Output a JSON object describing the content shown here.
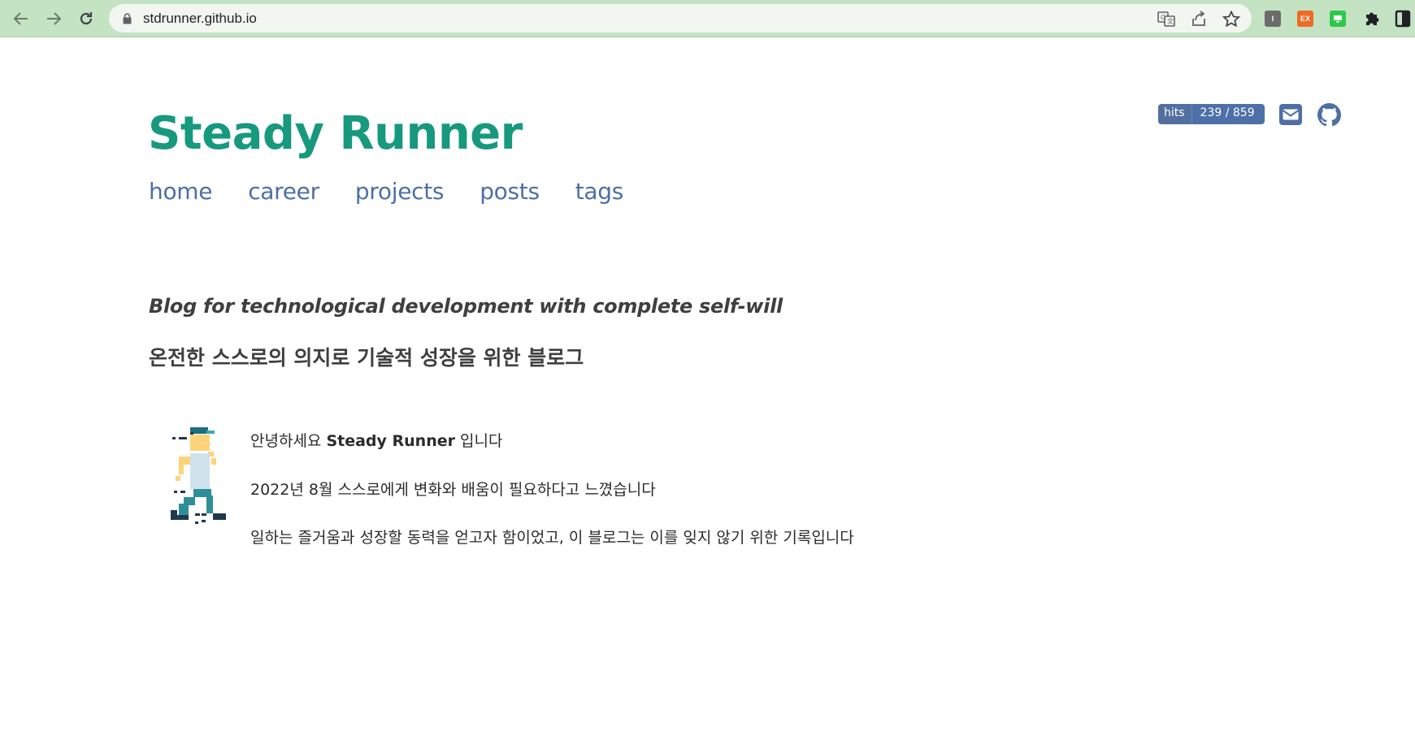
{
  "browser": {
    "url": "stdrunner.github.io",
    "extensions": [
      {
        "icon": "instapaper-extension-icon",
        "label": "I",
        "color": "#6b6b6b"
      },
      {
        "icon": "ex-extension-icon",
        "label": "EX",
        "color": "#f06a23"
      },
      {
        "icon": "screen-extension-icon",
        "label": "",
        "color": "#2ec84a"
      }
    ]
  },
  "site": {
    "title": "Steady Runner",
    "nav": [
      "home",
      "career",
      "projects",
      "posts",
      "tags"
    ],
    "hits": {
      "label": "hits",
      "count": "239 / 859"
    },
    "accent_color": "#17997e",
    "link_color": "#4d6fa6"
  },
  "main": {
    "tagline_en": "Blog for technological development with complete self-will",
    "tagline_ko": "온전한 스스로의 의지로 기술적 성장을 위한 블로그",
    "intro": {
      "greeting_prefix": "안녕하세요 ",
      "greeting_name": "Steady Runner",
      "greeting_suffix": " 입니다",
      "line2": "2022년 8월 스스로에게 변화와 배움이 필요하다고 느꼈습니다",
      "line3": "일하는 즐거움과 성장할 동력을 얻고자 함이었고, 이 블로그는 이를 잊지 않기 위한 기록입니다"
    }
  }
}
